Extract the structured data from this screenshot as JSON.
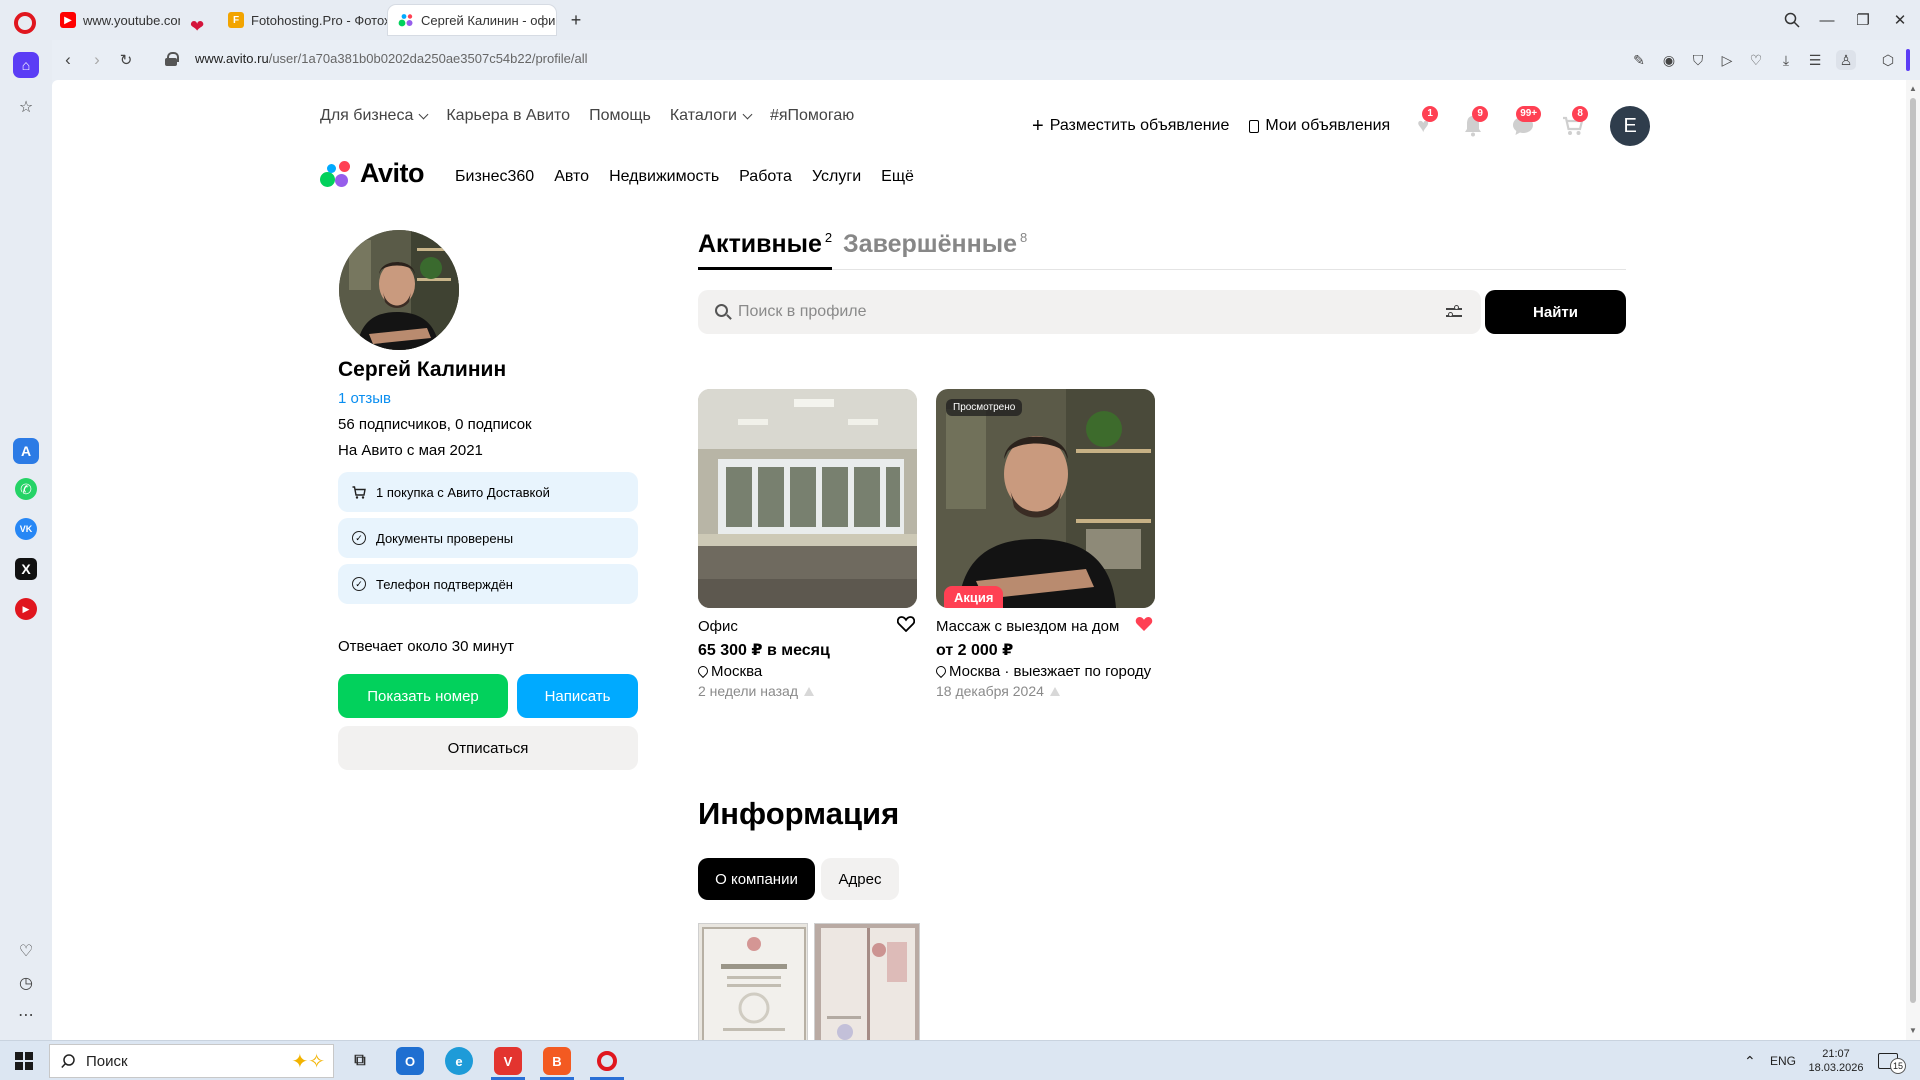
{
  "browser": {
    "tabs": [
      {
        "title": "www.youtube.com",
        "active": false
      },
      {
        "title": "Fotohosting.Pro - Фотохо",
        "active": false
      },
      {
        "title": "Сергей Калинин - офици",
        "active": true
      }
    ],
    "url_host": "www.avito.ru",
    "url_path": "/user/1a70a381b0b0202da250ae3507c54b22/profile/all"
  },
  "topnav": {
    "items": [
      "Для бизнеса",
      "Карьера в Авито",
      "Помощь",
      "Каталоги",
      "#яПомогаю"
    ],
    "post_ad": "Разместить объявление",
    "my_ads": "Мои объявления",
    "badges": {
      "favorites": "1",
      "notifications": "9",
      "messages": "99+",
      "cart": "8"
    },
    "user_initial": "E"
  },
  "logo": "Avito",
  "categories": [
    "Бизнес360",
    "Авто",
    "Недвижимость",
    "Работа",
    "Услуги",
    "Ещё"
  ],
  "profile": {
    "name": "Сергей Калинин",
    "reviews": "1 отзыв",
    "followers": "56 подписчиков, 0 подписок",
    "since": "На Авито с мая 2021",
    "verifications": [
      "1 покупка с Авито Доставкой",
      "Документы проверены",
      "Телефон подтверждён"
    ],
    "reply_time": "Отвечает около 30 минут",
    "show_phone": "Показать номер",
    "write": "Написать",
    "unsubscribe": "Отписаться"
  },
  "listing_tabs": {
    "active_label": "Активные",
    "active_count": "2",
    "finished_label": "Завершённые",
    "finished_count": "8"
  },
  "search": {
    "placeholder": "Поиск в профиле",
    "button": "Найти"
  },
  "listings": [
    {
      "title": "Офис",
      "price": "65 300 ₽ в месяц",
      "location": "Москва",
      "date": "2 недели назад",
      "favorite": false
    },
    {
      "title": "Массаж с выездом на дом",
      "price": "от 2 000 ₽",
      "location": "Москва · выезжает по городу",
      "date": "18 декабря 2024",
      "favorite": true,
      "viewed_badge": "Просмотрено",
      "promo_badge": "Акция"
    }
  ],
  "info": {
    "title": "Информация",
    "tabs": [
      "О компании",
      "Адрес"
    ]
  },
  "taskbar": {
    "search_placeholder": "Поиск",
    "lang": "ENG",
    "time": "21:07",
    "date": "18.03.2026",
    "notif_count": "15"
  },
  "colors": {
    "green": "#02d15c",
    "blue": "#00aaff",
    "badge_red": "#ff4053",
    "link": "#0a8ef0"
  }
}
